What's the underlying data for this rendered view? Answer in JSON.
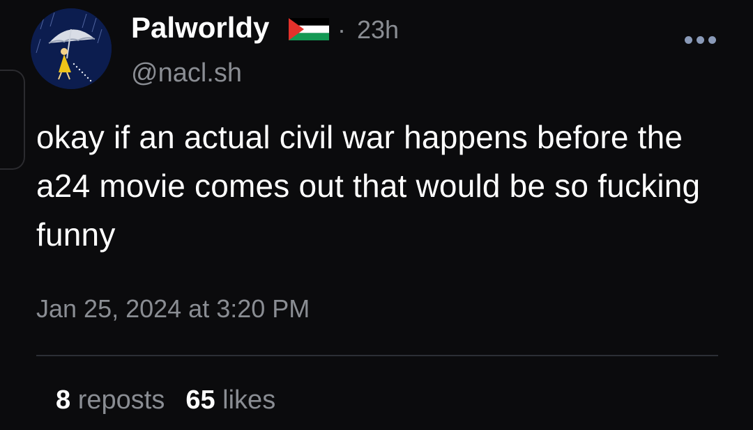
{
  "author": {
    "display_name": "Palworldy",
    "flag_icon": "palestine-flag-icon",
    "handle": "@nacl.sh",
    "relative_time": "23h",
    "separator": "·"
  },
  "menu": {
    "more_icon": "more-horizontal-icon"
  },
  "post": {
    "text": "okay if an actual civil war happens before the a24 movie comes out that would be so fucking funny",
    "date": "Jan 25, 2024 at 3:20 PM"
  },
  "stats": {
    "reposts_count": "8",
    "reposts_label": "reposts",
    "likes_count": "65",
    "likes_label": "likes"
  },
  "colors": {
    "background": "#0b0b0d",
    "primary_text": "#ffffff",
    "secondary_text": "#8a8d93",
    "divider": "#2c2f36",
    "more_dots": "#8a9ab8"
  }
}
